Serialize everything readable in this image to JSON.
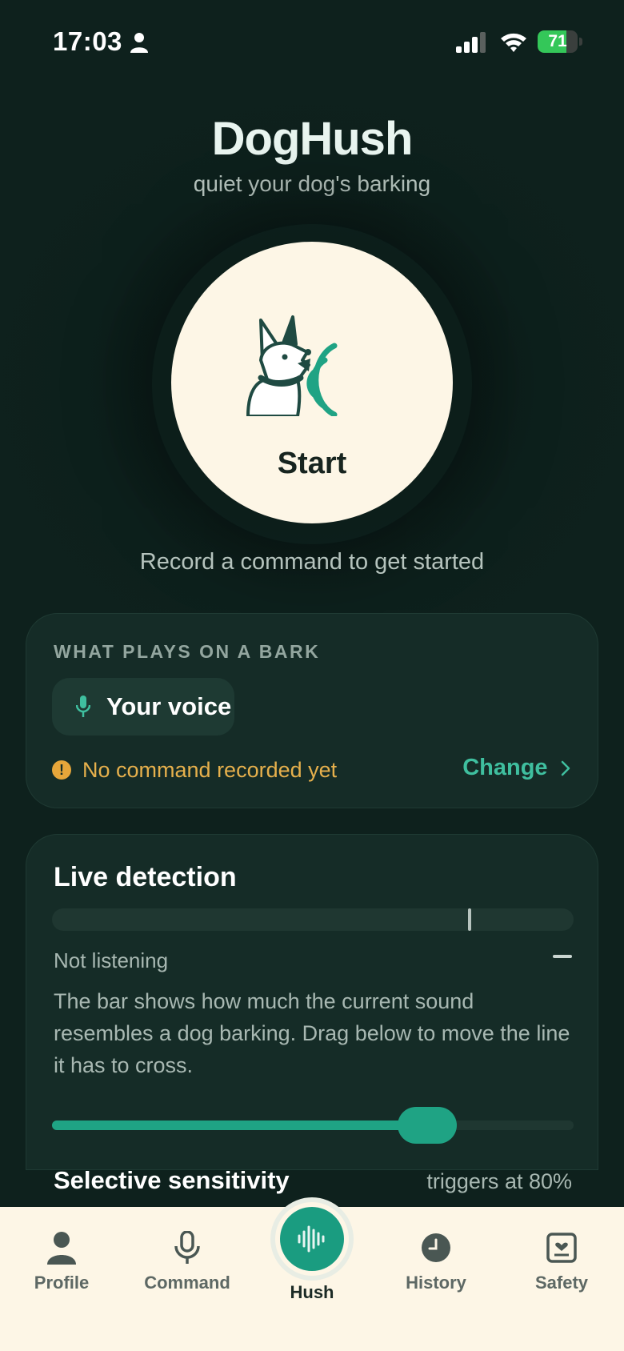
{
  "status_bar": {
    "time": "17:03",
    "battery_level": "71",
    "battery_fraction": 0.71,
    "battery_color": "#34c759"
  },
  "header": {
    "title": "DogHush",
    "subtitle": "quiet your dog's barking"
  },
  "start": {
    "label": "Start",
    "hint": "Record a command to get started",
    "icon": "barking-dog-icon"
  },
  "bark_card": {
    "kicker": "WHAT PLAYS ON A BARK",
    "voice_label": "Your voice",
    "warning": "No command recorded yet",
    "change_label": "Change",
    "warning_color": "#e6b04c",
    "accent_color": "#3fbf9f"
  },
  "live_card": {
    "title": "Live detection",
    "meter_threshold_percent": 80,
    "status": "Not listening",
    "description": "The bar shows how much the current sound resembles a dog barking. Drag below to move the line it has to cross.",
    "slider_percent": 72,
    "sensitivity_label": "Selective sensitivity",
    "sensitivity_value": "triggers at 80%"
  },
  "tabbar": {
    "tabs": [
      {
        "label": "Profile",
        "icon": "person-icon"
      },
      {
        "label": "Command",
        "icon": "microphone-icon"
      },
      {
        "label": "Hush",
        "icon": "sound-wave-icon",
        "active": true
      },
      {
        "label": "History",
        "icon": "clock-icon"
      },
      {
        "label": "Safety",
        "icon": "id-card-icon"
      }
    ]
  },
  "colors": {
    "background": "#0d201c",
    "card": "#152c27",
    "accent_green": "#1fa384",
    "cream": "#fdf6e6"
  }
}
